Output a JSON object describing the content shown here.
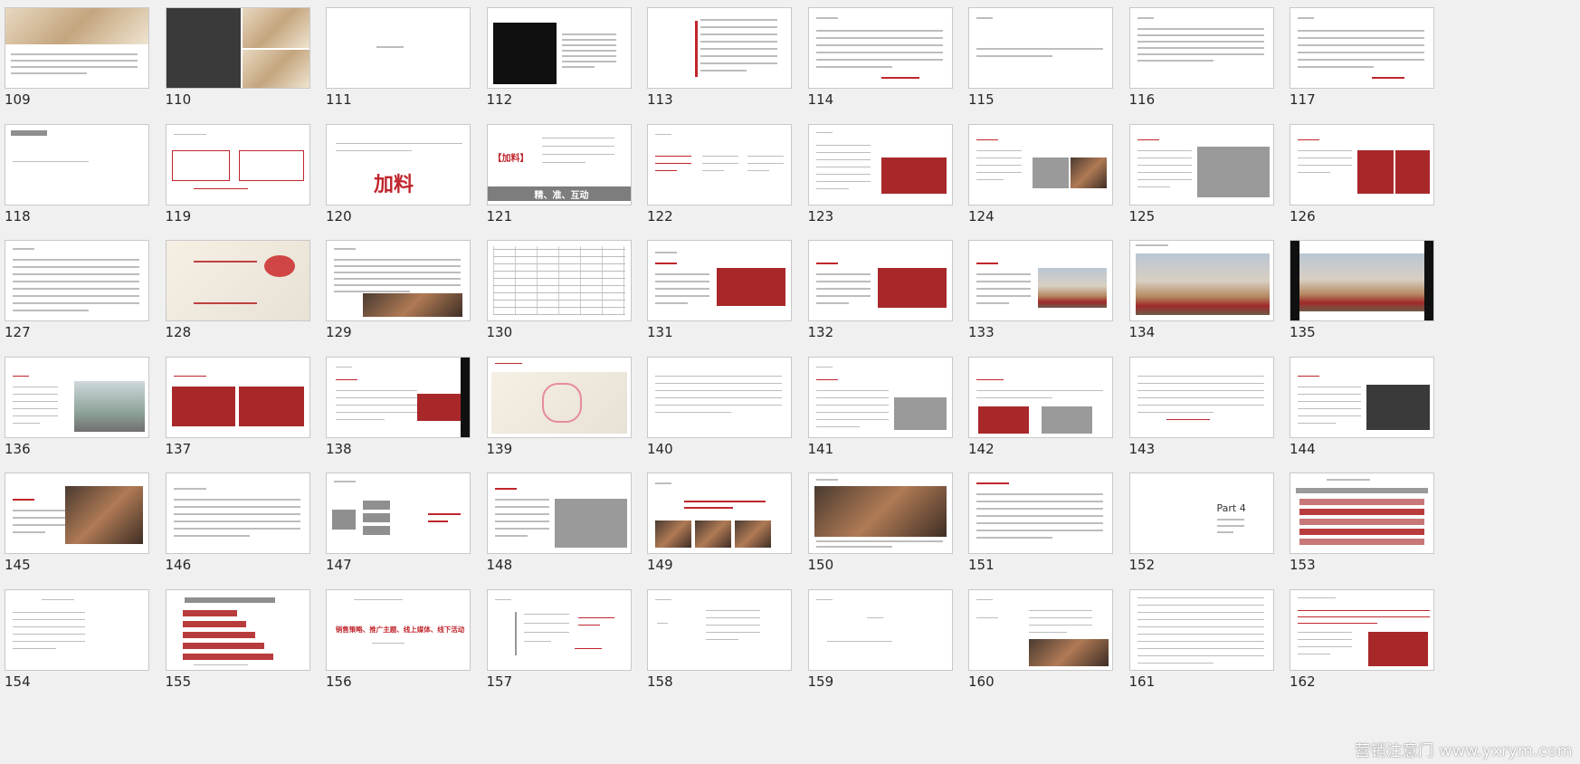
{
  "slides": [
    {
      "number": "109"
    },
    {
      "number": "110"
    },
    {
      "number": "111"
    },
    {
      "number": "112"
    },
    {
      "number": "113"
    },
    {
      "number": "114"
    },
    {
      "number": "115"
    },
    {
      "number": "116"
    },
    {
      "number": "117"
    },
    {
      "number": "118"
    },
    {
      "number": "119"
    },
    {
      "number": "120"
    },
    {
      "number": "121"
    },
    {
      "number": "122"
    },
    {
      "number": "123"
    },
    {
      "number": "124"
    },
    {
      "number": "125"
    },
    {
      "number": "126"
    },
    {
      "number": "127"
    },
    {
      "number": "128"
    },
    {
      "number": "129"
    },
    {
      "number": "130"
    },
    {
      "number": "131"
    },
    {
      "number": "132"
    },
    {
      "number": "133"
    },
    {
      "number": "134"
    },
    {
      "number": "135"
    },
    {
      "number": "136"
    },
    {
      "number": "137"
    },
    {
      "number": "138"
    },
    {
      "number": "139"
    },
    {
      "number": "140"
    },
    {
      "number": "141"
    },
    {
      "number": "142"
    },
    {
      "number": "143"
    },
    {
      "number": "144"
    },
    {
      "number": "145"
    },
    {
      "number": "146"
    },
    {
      "number": "147"
    },
    {
      "number": "148"
    },
    {
      "number": "149"
    },
    {
      "number": "150"
    },
    {
      "number": "151"
    },
    {
      "number": "152"
    },
    {
      "number": "153"
    },
    {
      "number": "154"
    },
    {
      "number": "155"
    },
    {
      "number": "156"
    },
    {
      "number": "157"
    },
    {
      "number": "158"
    },
    {
      "number": "159"
    },
    {
      "number": "160"
    },
    {
      "number": "161"
    },
    {
      "number": "162"
    }
  ],
  "slide_text": {
    "s120_big": "加料",
    "s121_bracket": "【加料】",
    "s121_banner": "精、准、互动",
    "s152_part": "Part 4",
    "s156_title": "销售策略、推广主题、线上媒体、线下活动"
  },
  "watermark": "营销注意门 www.yxrym.com",
  "colors": {
    "accent_red": "#c0262d",
    "background": "#f0f0f0",
    "slide_bg": "#ffffff"
  }
}
